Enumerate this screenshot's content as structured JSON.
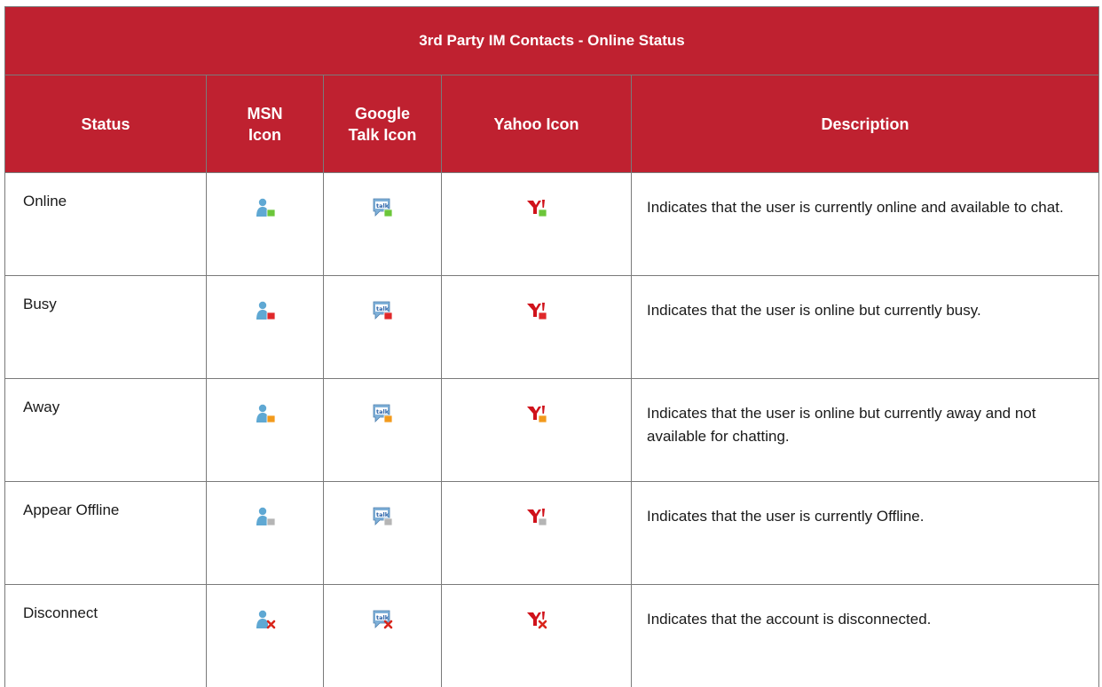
{
  "table": {
    "title": "3rd Party IM Contacts - Online Status",
    "headers": {
      "status": "Status",
      "msn_line1": "MSN",
      "msn_line2": "Icon",
      "gtalk_line1": "Google",
      "gtalk_line2": "Talk Icon",
      "yahoo": "Yahoo Icon",
      "description": "Description"
    },
    "rows": [
      {
        "status": "Online",
        "indicator": "online",
        "indicator_color": "#6cc63a",
        "msn_icon": "msn-online-icon",
        "gtalk_icon": "gtalk-online-icon",
        "yahoo_icon": "yahoo-online-icon",
        "description": "Indicates that the user is currently online and available to chat."
      },
      {
        "status": "Busy",
        "indicator": "busy",
        "indicator_color": "#e0282a",
        "msn_icon": "msn-busy-icon",
        "gtalk_icon": "gtalk-busy-icon",
        "yahoo_icon": "yahoo-busy-icon",
        "description": " Indicates that the user is online but currently busy."
      },
      {
        "status": "Away",
        "indicator": "away",
        "indicator_color": "#f29a1c",
        "msn_icon": "msn-away-icon",
        "gtalk_icon": "gtalk-away-icon",
        "yahoo_icon": "yahoo-away-icon",
        "description": "Indicates that the user is online but currently away and not available for chatting."
      },
      {
        "status": "Appear Offline",
        "indicator": "offline",
        "indicator_color": "#b5b5b5",
        "msn_icon": "msn-appear-offline-icon",
        "gtalk_icon": "gtalk-appear-offline-icon",
        "yahoo_icon": "yahoo-appear-offline-icon",
        "description": "Indicates that the user is currently Offline."
      },
      {
        "status": "Disconnect",
        "indicator": "disconnect",
        "indicator_color": "#d9261c",
        "msn_icon": "msn-disconnect-icon",
        "gtalk_icon": "gtalk-disconnect-icon",
        "yahoo_icon": "yahoo-disconnect-icon",
        "description": "Indicates that the account is disconnected."
      }
    ],
    "colors": {
      "header_bg": "#bf2130",
      "header_text": "#ffffff",
      "border": "#7a7a7a",
      "msn_person": "#5fa8d3",
      "gtalk_bubble": "#7fb0d8",
      "yahoo_red": "#d0121b"
    }
  }
}
